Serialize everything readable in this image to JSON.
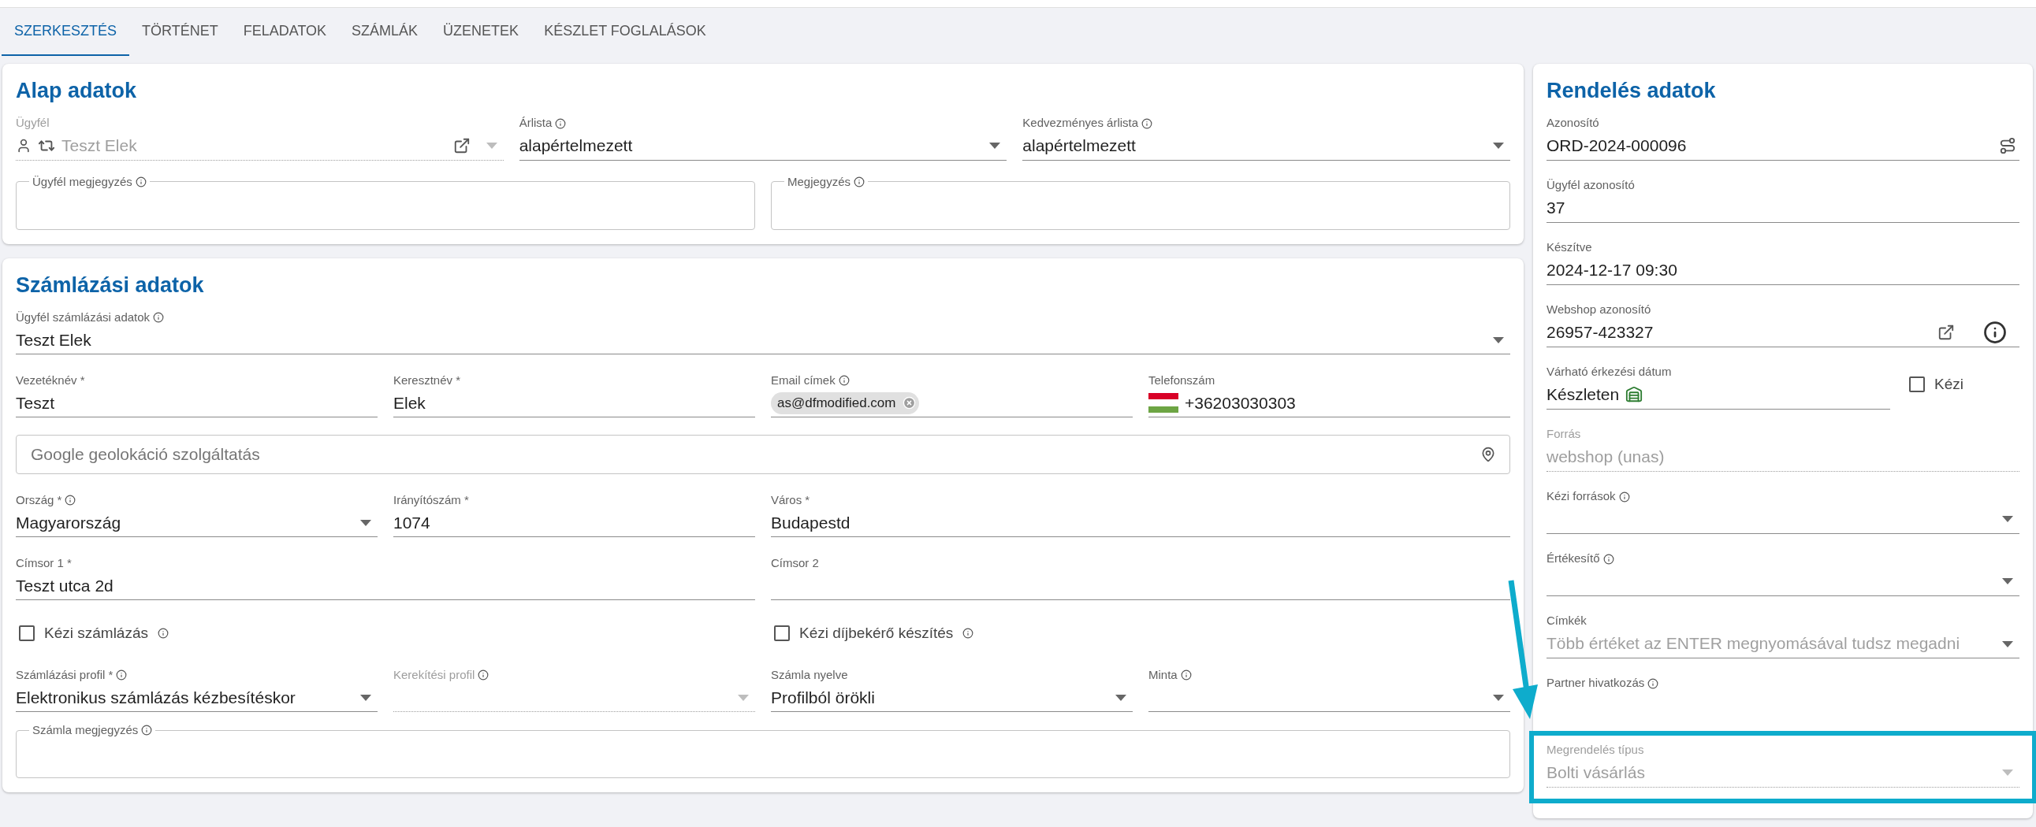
{
  "tabs": [
    {
      "label": "SZERKESZTÉS",
      "selected": true
    },
    {
      "label": "TÖRTÉNET",
      "selected": false
    },
    {
      "label": "FELADATOK",
      "selected": false
    },
    {
      "label": "SZÁMLÁK",
      "selected": false
    },
    {
      "label": "ÜZENETEK",
      "selected": false
    },
    {
      "label": "KÉSZLET FOGLALÁSOK",
      "selected": false
    }
  ],
  "base_card": {
    "title": "Alap adatok",
    "rows": [
      [
        {
          "kind": "customer",
          "label": "Ügyfél",
          "value": "Teszt Elek",
          "info": false,
          "disabled": true
        },
        {
          "kind": "select",
          "label": "Árlista",
          "value": "alapértelmezett",
          "info": true,
          "disabled": false
        },
        {
          "kind": "select",
          "label": "Kedvezményes árlista",
          "value": "alapértelmezett",
          "info": true,
          "disabled": false
        }
      ],
      [
        {
          "kind": "outlined",
          "label": "Ügyfél megjegyzés",
          "info": true,
          "disabled": false
        },
        {
          "kind": "outlined",
          "label": "Megjegyzés",
          "info": true,
          "disabled": false
        }
      ]
    ]
  },
  "billing_card": {
    "title": "Számlázási adatok",
    "rows": [
      [
        {
          "kind": "select",
          "label": "Ügyfél számlázási adatok",
          "value": "Teszt Elek",
          "info": true,
          "disabled": false
        }
      ],
      [
        {
          "kind": "text",
          "label": "Vezetéknév *",
          "value": "Teszt",
          "info": false,
          "disabled": false
        },
        {
          "kind": "text",
          "label": "Keresztnév *",
          "value": "Elek",
          "info": false,
          "disabled": false
        },
        {
          "kind": "chips",
          "label": "Email címek",
          "chips": [
            "as@dfmodified.com"
          ],
          "info": true,
          "disabled": false
        },
        {
          "kind": "phone",
          "label": "Telefonszám",
          "value": "+36203030303",
          "info": false,
          "disabled": false
        }
      ],
      [
        {
          "kind": "search",
          "placeholder": "Google geolokáció szolgáltatás",
          "disabled": false
        }
      ],
      [
        {
          "kind": "select",
          "label": "Ország *",
          "value": "Magyarország",
          "info": true,
          "disabled": false
        },
        {
          "kind": "text",
          "label": "Irányítószám *",
          "value": "1074",
          "info": false,
          "disabled": false
        },
        {
          "kind": "text",
          "label": "Város *",
          "value": "Budapestd",
          "info": false,
          "disabled": false
        }
      ],
      [
        {
          "kind": "text",
          "label": "Címsor 1 *",
          "value": "Teszt utca 2d",
          "info": false,
          "disabled": false
        },
        {
          "kind": "text",
          "label": "Címsor 2",
          "info": false,
          "disabled": false
        }
      ],
      [
        {
          "kind": "checkbox",
          "label": "Kézi számlázás",
          "checked": false,
          "info": true,
          "disabled": false
        },
        {
          "kind": "checkbox",
          "label": "Kézi díjbekérő készítés",
          "checked": false,
          "info": true,
          "disabled": false
        }
      ],
      [
        {
          "kind": "select",
          "label": "Számlázási profil *",
          "value": "Elektronikus számlázás kézbesítéskor",
          "info": true,
          "disabled": false
        },
        {
          "kind": "select",
          "label": "Kerekítési profil",
          "info": true,
          "disabled": true
        },
        {
          "kind": "select",
          "label": "Számla nyelve",
          "value": "Profilból örökli",
          "info": false,
          "disabled": false
        },
        {
          "kind": "select",
          "label": "Minta",
          "info": true,
          "disabled": false
        }
      ],
      [
        {
          "kind": "outlined",
          "label": "Számla megjegyzés",
          "info": true,
          "disabled": false
        }
      ]
    ]
  },
  "order_card": {
    "title": "Rendelés adatok",
    "fields": [
      {
        "kind": "id",
        "label": "Azonosító",
        "value": "ORD-2024-000096",
        "info": false,
        "disabled": false,
        "highlighted": false
      },
      {
        "kind": "text",
        "label": "Ügyfél azonosító",
        "value": "37",
        "info": false,
        "disabled": false,
        "highlighted": false
      },
      {
        "kind": "text",
        "label": "Készítve",
        "value": "2024-12-17 09:30",
        "info": false,
        "disabled": false,
        "highlighted": false
      },
      {
        "kind": "webshop",
        "label": "Webshop azonosító",
        "value": "26957-423327",
        "info": false,
        "disabled": false,
        "highlighted": false
      },
      {
        "kind": "stock",
        "label": "Várható érkezési dátum",
        "value": "Készleten",
        "info": false,
        "disabled": false,
        "highlighted": false,
        "checkbox_label": "Kézi",
        "checked": false
      },
      {
        "kind": "text",
        "label": "Forrás",
        "value": "webshop (unas)",
        "info": false,
        "disabled": true,
        "highlighted": false
      },
      {
        "kind": "select",
        "label": "Kézi források",
        "info": true,
        "disabled": false,
        "highlighted": false
      },
      {
        "kind": "select",
        "label": "Értékesítő",
        "info": true,
        "disabled": false,
        "highlighted": false
      },
      {
        "kind": "select",
        "label": "Címkék",
        "placeholder": "Több értéket az ENTER megnyomásával tudsz megadni",
        "info": false,
        "disabled": false,
        "highlighted": false
      },
      {
        "kind": "plain",
        "label": "Partner hivatkozás",
        "info": true,
        "disabled": false,
        "highlighted": false
      },
      {
        "kind": "select",
        "label": "Megrendelés típus",
        "value": "Bolti vásárlás",
        "info": false,
        "disabled": true,
        "highlighted": true
      }
    ]
  }
}
